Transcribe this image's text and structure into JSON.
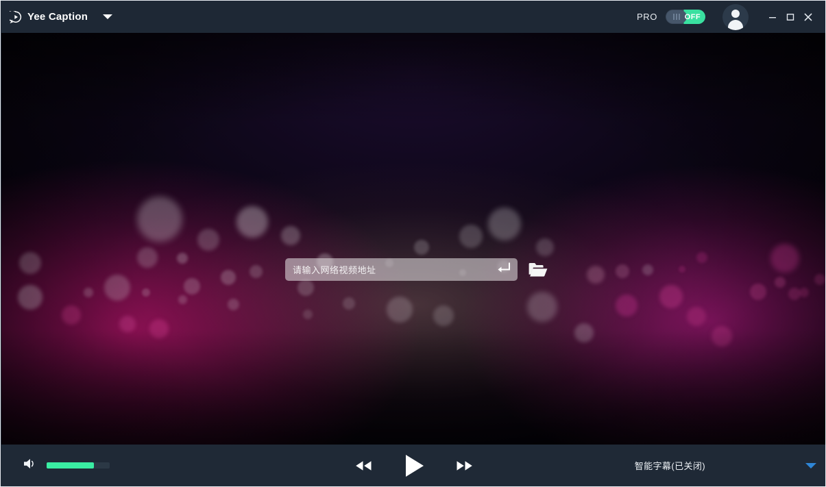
{
  "window": {
    "app_title": "Yee Caption",
    "brand_icon": "play-circle-chat-icon",
    "title_dropdown_icon": "chevron-down-icon"
  },
  "titlebar": {
    "pro_label": "PRO",
    "toggle_state_label": "OFF",
    "toggle_on_color": "#3ae0a0",
    "toggle_off_color": "#46566a",
    "avatar_icon": "user-avatar-icon",
    "minimize_label": "–",
    "maximize_label": "□",
    "close_label": "✕"
  },
  "stage": {
    "url_input": {
      "placeholder": "请输入网络视频地址",
      "value": "",
      "enter_icon": "enter-return-icon"
    },
    "open_folder_icon": "folder-open-icon",
    "background": {
      "base_color": "#0d0612",
      "accent_magenta": "#be146e",
      "accent_pink": "#c41c8c"
    }
  },
  "controls": {
    "volume_icon": "speaker-volume-icon",
    "volume_percent": 75,
    "volume_fill_color": "#3aeda3",
    "rewind_icon": "rewind-icon",
    "play_icon": "play-icon",
    "forward_icon": "fast-forward-icon",
    "subtitle_label": "智能字幕(已关闭)",
    "subtitle_caret_icon": "chevron-down-icon",
    "subtitle_caret_color": "#2f86d6"
  }
}
